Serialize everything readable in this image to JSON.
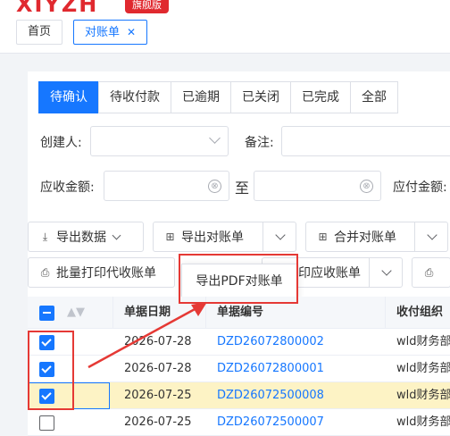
{
  "header": {
    "logo_text": "XIYZH",
    "logo_badge": "旗舰版"
  },
  "tabs": [
    {
      "label": "首页"
    },
    {
      "label": "对账单",
      "close": "✕"
    }
  ],
  "status_tabs": [
    "待确认",
    "待收付款",
    "已逾期",
    "已关闭",
    "已完成",
    "全部"
  ],
  "filters": {
    "creator_label": "创建人:",
    "remark_label": "备注:",
    "receivable_label": "应收金额:",
    "to_label": "至",
    "payable_label": "应付金额:",
    "clear_icon": "⊗"
  },
  "toolbar": {
    "export_data": "导出数据",
    "export_statement": "导出对账单",
    "merge_statement": "合并对账单",
    "batch_print": "批量打印代收账单",
    "print_receipt": "印应收账单",
    "tooltip": "导出PDF对账单"
  },
  "table": {
    "columns": [
      "单据日期",
      "单据编号",
      "收付组织"
    ],
    "rows": [
      {
        "date": "2026-07-28",
        "code": "DZD26072800002",
        "org": "wld财务部",
        "checked": true,
        "highlight": false
      },
      {
        "date": "2026-07-28",
        "code": "DZD26072800001",
        "org": "wld财务部",
        "checked": true,
        "highlight": false
      },
      {
        "date": "2026-07-25",
        "code": "DZD26072500008",
        "org": "wld财务部",
        "checked": true,
        "highlight": true
      },
      {
        "date": "2026-07-25",
        "code": "DZD26072500007",
        "org": "wld财务部",
        "checked": false,
        "highlight": false
      }
    ]
  },
  "colors": {
    "accent": "#1677ff",
    "annotation": "#e53935",
    "highlight_row": "#fdf3c5"
  }
}
